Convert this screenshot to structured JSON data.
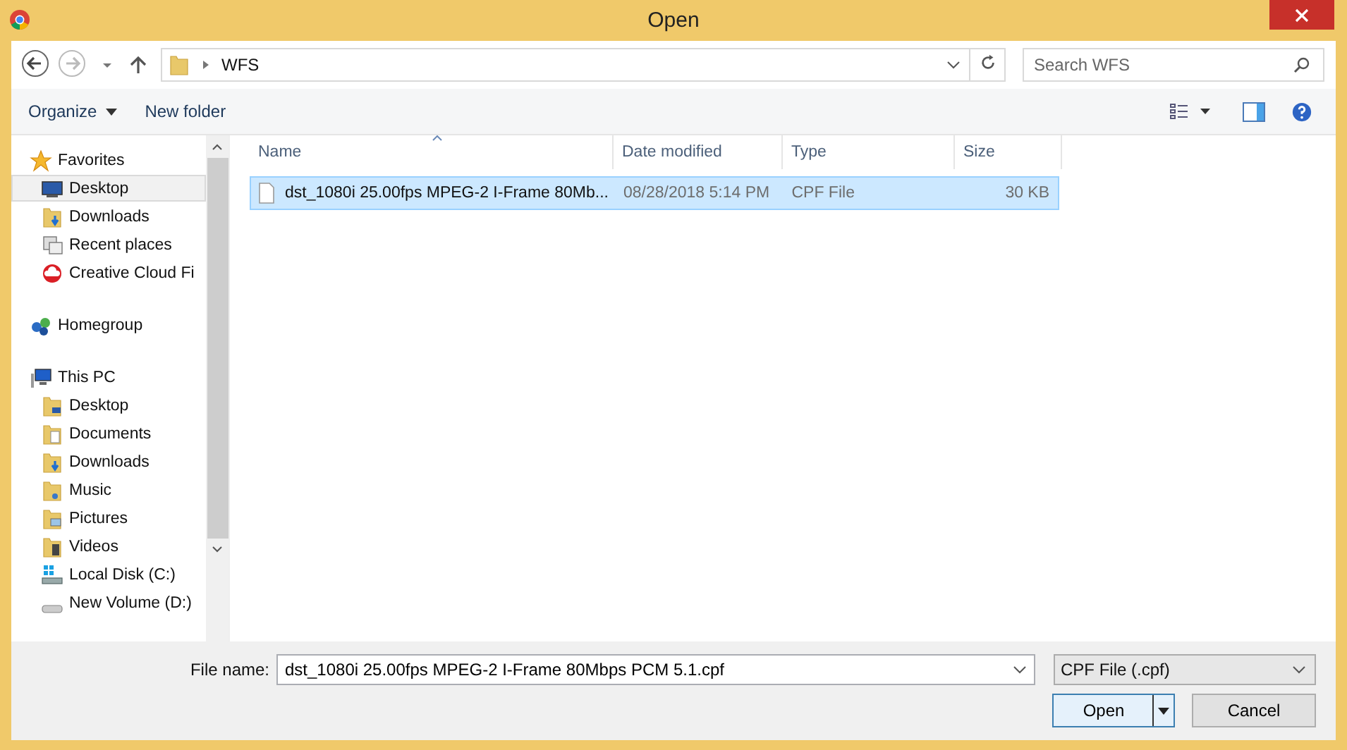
{
  "window": {
    "title": "Open"
  },
  "address": {
    "path": [
      "WFS"
    ],
    "search_placeholder": "Search WFS"
  },
  "toolbar": {
    "organize": "Organize",
    "new_folder": "New folder"
  },
  "sidebar": {
    "items": [
      {
        "label": "Favorites",
        "kind": "star",
        "children": [
          {
            "label": "Desktop",
            "kind": "desktop",
            "selected": true
          },
          {
            "label": "Downloads",
            "kind": "download",
            "selected": false
          },
          {
            "label": "Recent places",
            "kind": "recent",
            "selected": false
          },
          {
            "label": "Creative Cloud Fi",
            "kind": "cloud",
            "selected": false
          }
        ]
      },
      {
        "label": "Homegroup",
        "kind": "homegroup"
      },
      {
        "label": "This PC",
        "kind": "pc",
        "children": [
          {
            "label": "Desktop",
            "kind": "folder-desktop",
            "selected": false
          },
          {
            "label": "Documents",
            "kind": "documents",
            "selected": false
          },
          {
            "label": "Downloads",
            "kind": "download",
            "selected": false
          },
          {
            "label": "Music",
            "kind": "music",
            "selected": false
          },
          {
            "label": "Pictures",
            "kind": "pictures",
            "selected": false
          },
          {
            "label": "Videos",
            "kind": "videos",
            "selected": false
          },
          {
            "label": "Local Disk (C:)",
            "kind": "disk",
            "selected": false
          },
          {
            "label": "New Volume (D:)",
            "kind": "drive",
            "selected": false
          }
        ]
      }
    ]
  },
  "table": {
    "columns": [
      {
        "label": "Name",
        "sorted": true
      },
      {
        "label": "Date modified",
        "sorted": false
      },
      {
        "label": "Type",
        "sorted": false
      },
      {
        "label": "Size",
        "sorted": false
      }
    ],
    "rows": [
      {
        "name": "dst_1080i 25.00fps MPEG-2 I-Frame 80Mb...",
        "date": "08/28/2018 5:14 PM",
        "type": "CPF File",
        "size": "30 KB",
        "selected": true
      }
    ]
  },
  "footer": {
    "file_name_label": "File name:",
    "file_name": "dst_1080i 25.00fps MPEG-2 I-Frame 80Mbps PCM 5.1.cpf",
    "file_type": "CPF File (.cpf)",
    "buttons": [
      "Open",
      "Cancel"
    ]
  }
}
